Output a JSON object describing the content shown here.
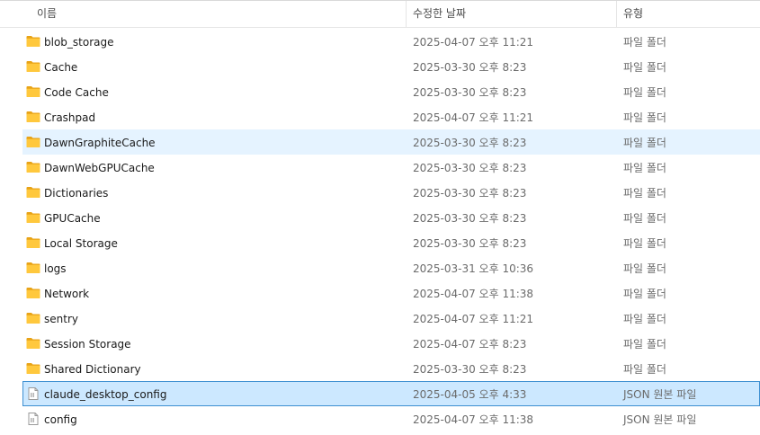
{
  "header": {
    "name_label": "이름",
    "date_label": "수정한 날짜",
    "type_label": "유형",
    "sort_indicator": "^"
  },
  "colors": {
    "folder": "#ffc83d",
    "folder_dark": "#e8a317",
    "hover_row": "#e5f3ff",
    "selected_row": "#cce8ff",
    "selected_border": "#3d8fd1"
  },
  "files": [
    {
      "name": "blob_storage",
      "date": "2025-04-07 오후 11:21",
      "type": "파일 폴더",
      "icon": "folder-icon"
    },
    {
      "name": "Cache",
      "date": "2025-03-30 오후 8:23",
      "type": "파일 폴더",
      "icon": "folder-icon"
    },
    {
      "name": "Code Cache",
      "date": "2025-03-30 오후 8:23",
      "type": "파일 폴더",
      "icon": "folder-icon"
    },
    {
      "name": "Crashpad",
      "date": "2025-04-07 오후 11:21",
      "type": "파일 폴더",
      "icon": "folder-icon"
    },
    {
      "name": "DawnGraphiteCache",
      "date": "2025-03-30 오후 8:23",
      "type": "파일 폴더",
      "icon": "folder-icon",
      "state": "hover"
    },
    {
      "name": "DawnWebGPUCache",
      "date": "2025-03-30 오후 8:23",
      "type": "파일 폴더",
      "icon": "folder-icon"
    },
    {
      "name": "Dictionaries",
      "date": "2025-03-30 오후 8:23",
      "type": "파일 폴더",
      "icon": "folder-icon"
    },
    {
      "name": "GPUCache",
      "date": "2025-03-30 오후 8:23",
      "type": "파일 폴더",
      "icon": "folder-icon"
    },
    {
      "name": "Local Storage",
      "date": "2025-03-30 오후 8:23",
      "type": "파일 폴더",
      "icon": "folder-icon"
    },
    {
      "name": "logs",
      "date": "2025-03-31 오후 10:36",
      "type": "파일 폴더",
      "icon": "folder-icon"
    },
    {
      "name": "Network",
      "date": "2025-04-07 오후 11:38",
      "type": "파일 폴더",
      "icon": "folder-icon"
    },
    {
      "name": "sentry",
      "date": "2025-04-07 오후 11:21",
      "type": "파일 폴더",
      "icon": "folder-icon"
    },
    {
      "name": "Session Storage",
      "date": "2025-04-07 오후 8:23",
      "type": "파일 폴더",
      "icon": "folder-icon"
    },
    {
      "name": "Shared Dictionary",
      "date": "2025-03-30 오후 8:23",
      "type": "파일 폴더",
      "icon": "folder-icon"
    },
    {
      "name": "claude_desktop_config",
      "date": "2025-04-05 오후 4:33",
      "type": "JSON 원본 파일",
      "icon": "json-file-icon",
      "state": "selected"
    },
    {
      "name": "config",
      "date": "2025-04-07 오후 11:38",
      "type": "JSON 원본 파일",
      "icon": "json-file-icon"
    }
  ]
}
